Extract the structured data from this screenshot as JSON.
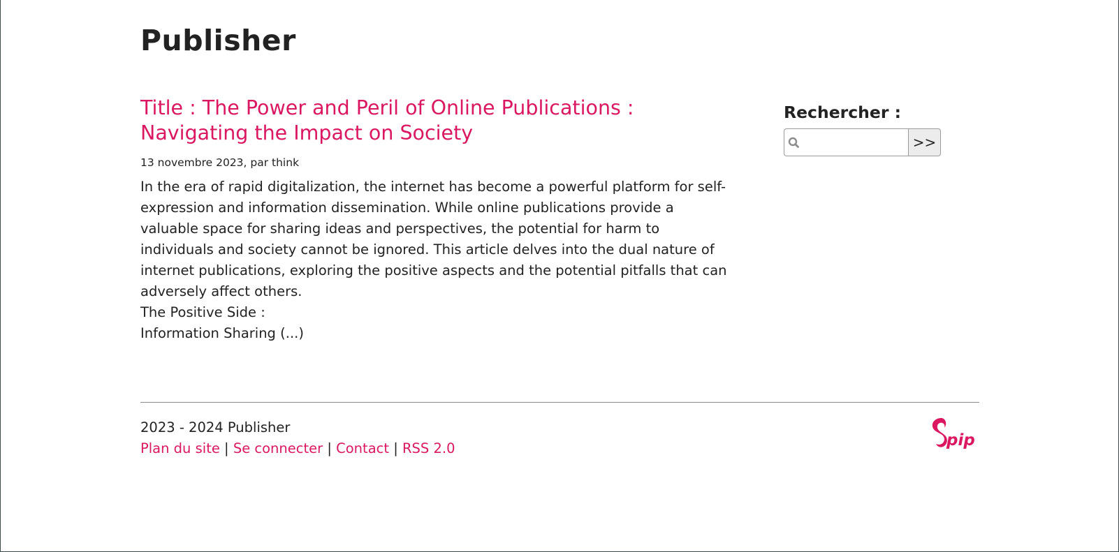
{
  "site": {
    "title": "Publisher"
  },
  "article": {
    "title": "Title : The Power and Peril of Online Publications : Navigating the Impact on Society",
    "meta": "13 novembre 2023, par think",
    "intro": "In the era of rapid digitalization, the internet has become a powerful platform for self-expression and information dissemination. While online publications provide a valuable space for sharing ideas and perspectives, the potential for harm to individuals and society cannot be ignored. This article delves into the dual nature of internet publications, exploring the positive aspects and the potential pitfalls that can adversely affect others.",
    "line2": "The Positive Side :",
    "line3": "Information Sharing (...)"
  },
  "sidebar": {
    "search_label": "Rechercher :",
    "search_value": "",
    "search_placeholder": "",
    "search_button": ">>"
  },
  "footer": {
    "copyright": "2023 - 2024 Publisher",
    "links": [
      "Plan du site",
      "Se connecter",
      "Contact",
      "RSS 2.0"
    ],
    "separator": "|",
    "logo_text": "spip"
  },
  "colors": {
    "accent": "#db1762",
    "text": "#222222",
    "background": "#ffffff"
  },
  "icons": {
    "search": "magnifier-icon",
    "logo": "spip-logo"
  }
}
